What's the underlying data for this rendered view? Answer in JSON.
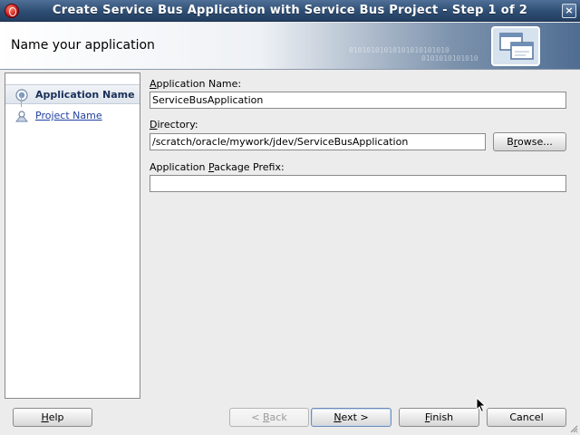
{
  "window": {
    "title": "Create Service Bus Application with Service Bus Project - Step 1 of 2",
    "close_glyph": "×"
  },
  "header": {
    "heading": "Name your application",
    "binary_line1": "01010101010101010101010",
    "binary_line2": "0101010101010"
  },
  "nav": {
    "items": [
      {
        "label": "Application Name",
        "state": "active",
        "icon": "step-current-icon"
      },
      {
        "label": "Project Name",
        "state": "link",
        "icon": "step-pending-icon"
      }
    ]
  },
  "form": {
    "app_name": {
      "label_pre": "",
      "label_mn": "A",
      "label_post": "pplication Name:",
      "value": "ServiceBusApplication"
    },
    "directory": {
      "label_pre": "",
      "label_mn": "D",
      "label_post": "irectory:",
      "value": "/scratch/oracle/mywork/jdev/ServiceBusApplication",
      "browse_pre": "B",
      "browse_mn": "r",
      "browse_post": "owse..."
    },
    "package_prefix": {
      "label_pre": "Application ",
      "label_mn": "P",
      "label_post": "ackage Prefix:",
      "value": ""
    }
  },
  "buttons": {
    "help": {
      "mn": "H",
      "rest": "elp"
    },
    "back": {
      "pre": "< ",
      "mn": "B",
      "post": "ack",
      "disabled": true
    },
    "next": {
      "mn": "N",
      "post": "ext >"
    },
    "finish": {
      "mn": "F",
      "post": "inish"
    },
    "cancel": {
      "label": "Cancel"
    }
  },
  "colors": {
    "titlebar": "#2e4d73",
    "nav_link": "#1f3fa0",
    "accent_red": "#c4161c"
  }
}
